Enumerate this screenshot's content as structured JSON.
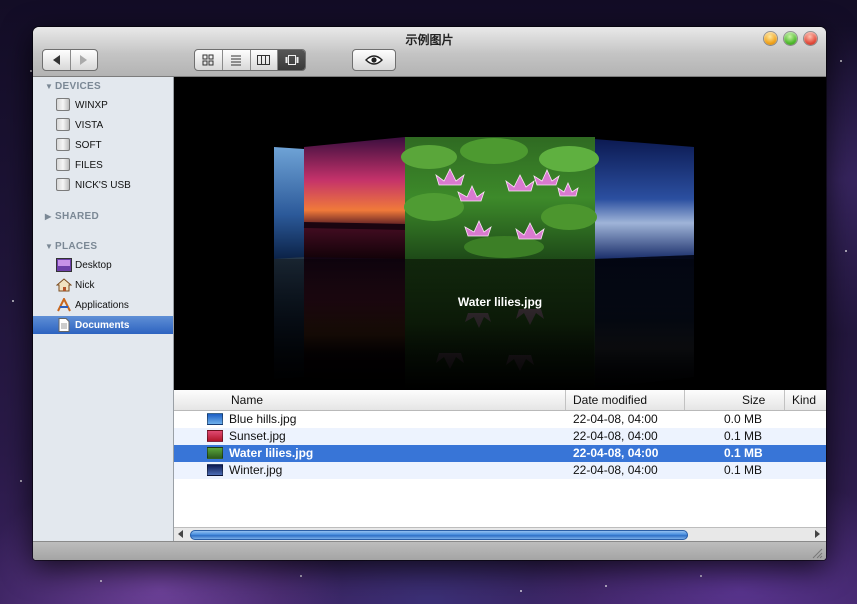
{
  "window": {
    "title": "示例图片"
  },
  "sidebar": {
    "devices_label": "DEVICES",
    "devices": [
      "WINXP",
      "VISTA",
      "SOFT",
      "FILES",
      "NICK'S USB"
    ],
    "shared_label": "SHARED",
    "places_label": "PLACES",
    "places": [
      {
        "label": "Desktop",
        "icon": "desktop-icon"
      },
      {
        "label": "Nick",
        "icon": "home-icon"
      },
      {
        "label": "Applications",
        "icon": "applications-icon"
      },
      {
        "label": "Documents",
        "icon": "documents-icon",
        "selected": true
      }
    ]
  },
  "coverflow": {
    "current_label": "Water lilies.jpg"
  },
  "list": {
    "columns": {
      "name": "Name",
      "date": "Date modified",
      "size": "Size",
      "kind": "Kind"
    },
    "rows": [
      {
        "name": "Blue hills.jpg",
        "date": "22-04-08, 04:00",
        "size": "0.0 MB",
        "thumb": "#2a72d0"
      },
      {
        "name": "Sunset.jpg",
        "date": "22-04-08, 04:00",
        "size": "0.1 MB",
        "thumb": "#c8333f"
      },
      {
        "name": "Water lilies.jpg",
        "date": "22-04-08, 04:00",
        "size": "0.1 MB",
        "thumb": "#3c6a2a",
        "selected": true
      },
      {
        "name": "Winter.jpg",
        "date": "22-04-08, 04:00",
        "size": "0.1 MB",
        "thumb": "#1a2a6a"
      }
    ]
  },
  "colors": {
    "selection": "#3875d7",
    "sidebar_bg": "#e3e8ee",
    "alt_row": "#edf3fe"
  }
}
